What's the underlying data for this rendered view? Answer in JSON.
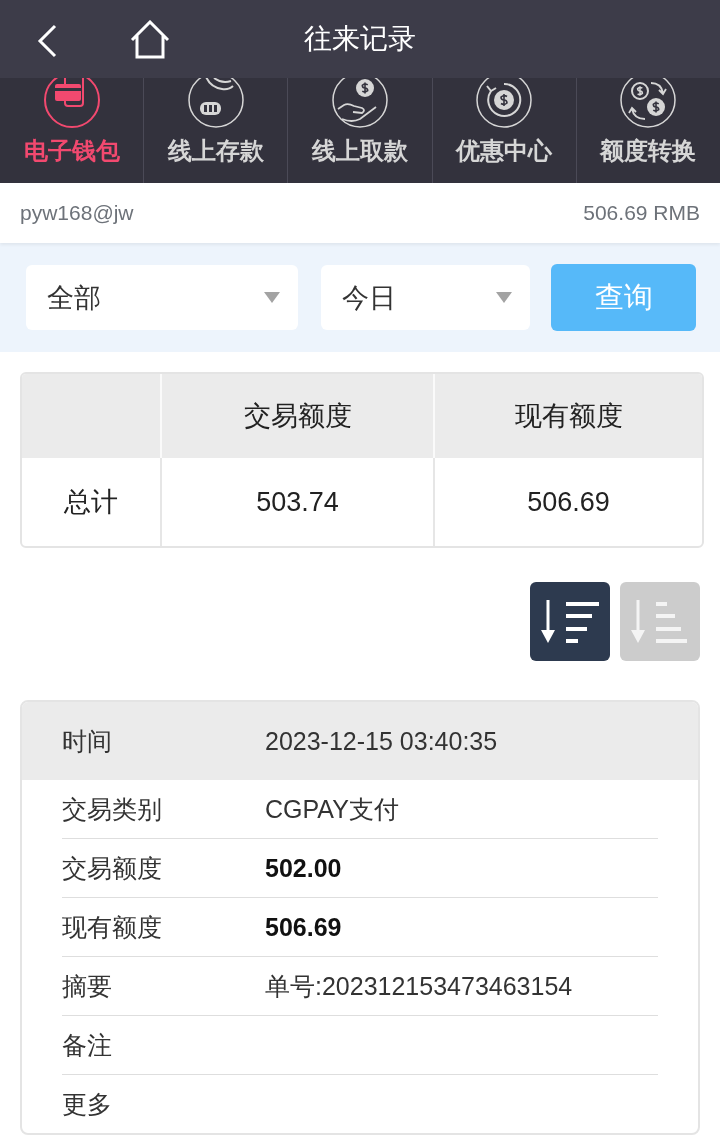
{
  "header": {
    "title": "往来记录"
  },
  "nav": [
    {
      "label": "电子钱包",
      "kind": "wallet",
      "selected": true
    },
    {
      "label": "线上存款",
      "kind": "deposit",
      "selected": false
    },
    {
      "label": "线上取款",
      "kind": "withdraw",
      "selected": false
    },
    {
      "label": "优惠中心",
      "kind": "promo",
      "selected": false
    },
    {
      "label": "额度转换",
      "kind": "transfer",
      "selected": false
    }
  ],
  "account": {
    "username": "pyw168@jw",
    "balance": "506.69 RMB"
  },
  "filters": {
    "selects": [
      {
        "value": "全部"
      },
      {
        "value": "今日"
      }
    ],
    "button": "查询"
  },
  "summary": {
    "columns": [
      "交易额度",
      "现有额度"
    ],
    "rows": [
      {
        "label": "总计",
        "values": [
          "503.74",
          "506.69"
        ]
      }
    ]
  },
  "sort_buttons": [
    {
      "kind": "descending",
      "selected": true
    },
    {
      "kind": "ascending",
      "selected": false
    }
  ],
  "record": {
    "header": {
      "label": "时间",
      "value": "2023-12-15 03:40:35"
    },
    "rows": [
      {
        "label": "交易类别",
        "value": "CGPAY支付",
        "kind": "text"
      },
      {
        "label": "交易额度",
        "value": "502.00",
        "kind": "amount"
      },
      {
        "label": "现有额度",
        "value": "506.69",
        "kind": "amount"
      },
      {
        "label": "摘要",
        "value": "单号:202312153473463154",
        "kind": "text"
      },
      {
        "label": "备注"
      },
      {
        "label": "更多"
      }
    ]
  }
}
